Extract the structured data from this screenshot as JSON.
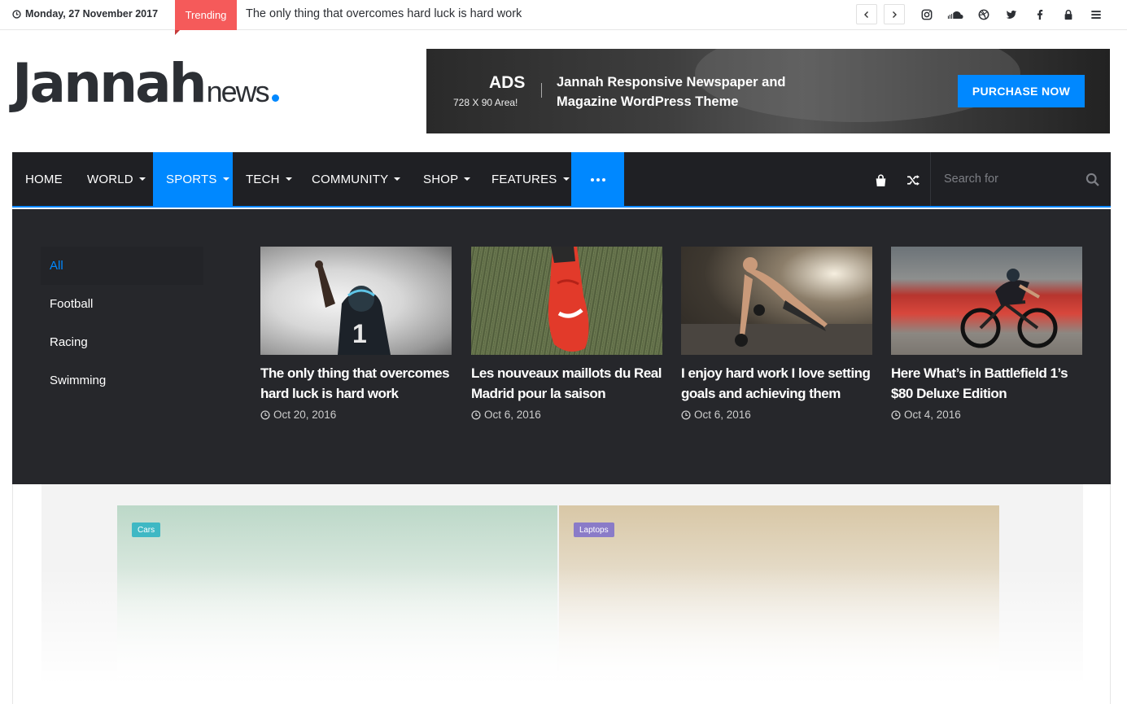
{
  "topbar": {
    "date": "Monday, 27 November 2017",
    "trending_label": "Trending",
    "trending_text": "The only thing that overcomes hard luck is hard work",
    "social_icons": [
      "instagram-icon",
      "soundcloud-icon",
      "dribbble-icon",
      "twitter-icon",
      "facebook-icon",
      "lock-icon",
      "menu-icon"
    ]
  },
  "logo": {
    "main": "Jannah",
    "sub": "news"
  },
  "ad": {
    "label": "ADS",
    "size": "728 X 90 Area!",
    "title": "Jannah Responsive Newspaper and Magazine WordPress Theme",
    "button": "PURCHASE NOW"
  },
  "nav": {
    "items": [
      {
        "label": "HOME",
        "caret": false
      },
      {
        "label": "WORLD",
        "caret": true
      },
      {
        "label": "SPORTS",
        "caret": true,
        "active": true
      },
      {
        "label": "TECH",
        "caret": true
      },
      {
        "label": "COMMUNITY",
        "caret": true
      },
      {
        "label": "SHOP",
        "caret": true
      },
      {
        "label": "FEATURES",
        "caret": true
      }
    ],
    "search_placeholder": "Search for"
  },
  "mega": {
    "categories": [
      "All",
      "Football",
      "Racing",
      "Swimming"
    ],
    "posts": [
      {
        "title": "The only thing that overcomes hard luck is hard work",
        "date": "Oct 20, 2016"
      },
      {
        "title": "Les nouveaux maillots du Real Madrid pour la saison",
        "date": "Oct 6, 2016"
      },
      {
        "title": "I enjoy hard work I love setting goals and achieving them",
        "date": "Oct 6, 2016"
      },
      {
        "title": "Here What’s in Battlefield 1’s $80 Deluxe Edition",
        "date": "Oct 4, 2016"
      }
    ]
  },
  "background": {
    "tags": [
      "Cars",
      "Laptops"
    ]
  },
  "colors": {
    "accent": "#0088ff",
    "trending": "#f55a5a",
    "nav_bg": "#1f2024"
  }
}
